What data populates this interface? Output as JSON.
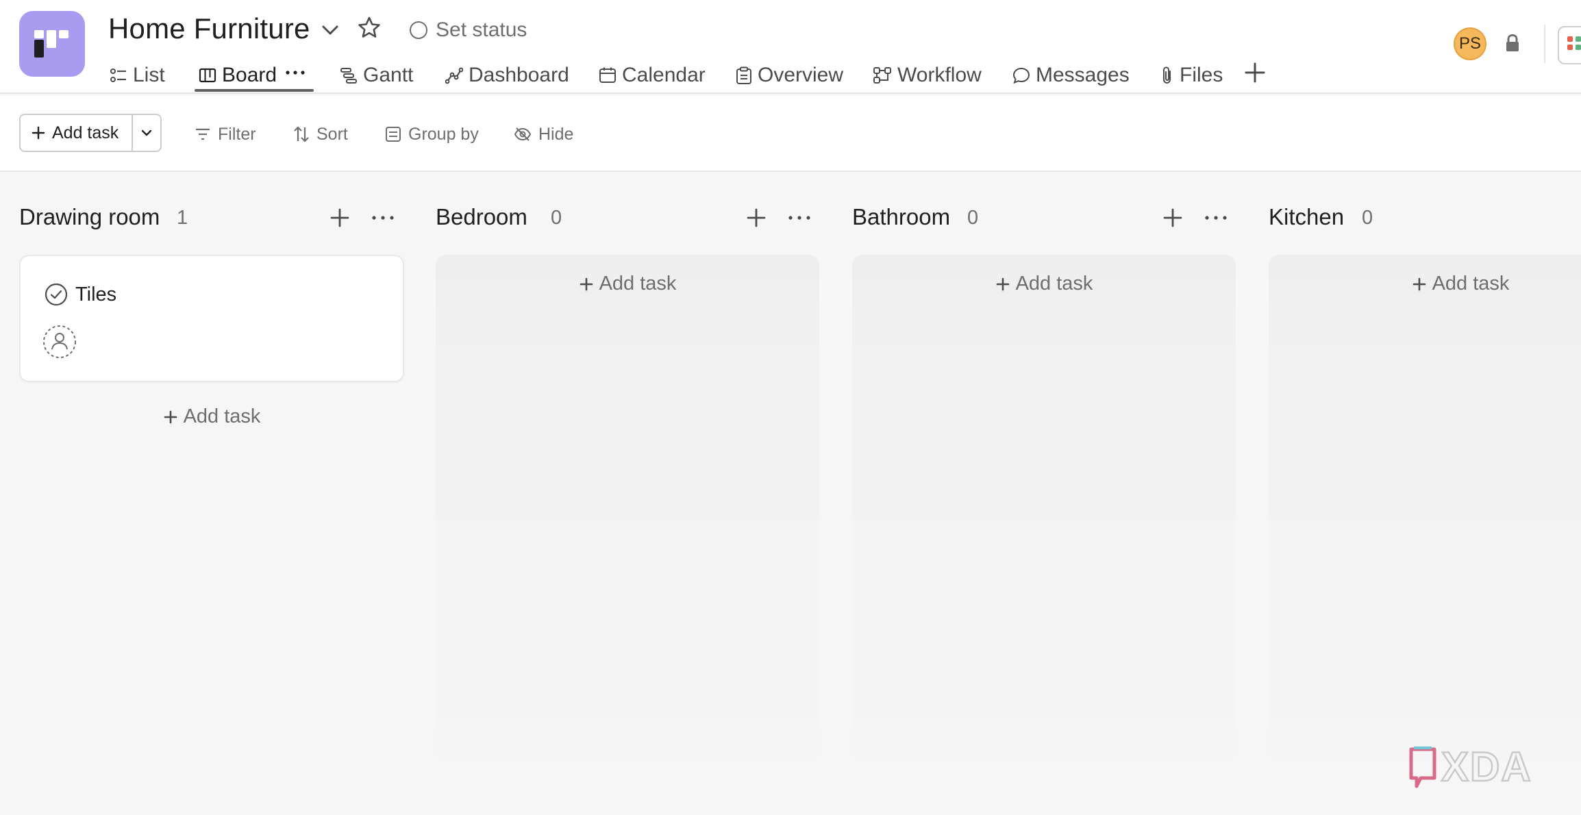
{
  "header": {
    "project_title": "Home Furniture",
    "project_icon": "board-icon",
    "set_status_label": "Set status",
    "avatar_initials": "PS",
    "tabs": [
      {
        "label": "List",
        "icon": "list-icon"
      },
      {
        "label": "Board",
        "icon": "board-icon",
        "active": true
      },
      {
        "label": "Gantt",
        "icon": "gantt-icon"
      },
      {
        "label": "Dashboard",
        "icon": "dashboard-icon"
      },
      {
        "label": "Calendar",
        "icon": "calendar-icon"
      },
      {
        "label": "Overview",
        "icon": "clipboard-icon"
      },
      {
        "label": "Workflow",
        "icon": "workflow-icon"
      },
      {
        "label": "Messages",
        "icon": "speech-bubble-icon"
      },
      {
        "label": "Files",
        "icon": "paperclip-icon"
      }
    ]
  },
  "toolbar": {
    "add_task_label": "Add task",
    "filter_label": "Filter",
    "sort_label": "Sort",
    "group_by_label": "Group by",
    "hide_label": "Hide"
  },
  "board": {
    "columns": [
      {
        "title": "Drawing room",
        "count": "1",
        "add_task_label": "Add task",
        "tasks": [
          {
            "name": "Tiles"
          }
        ]
      },
      {
        "title": "Bedroom",
        "count": "0",
        "add_task_label": "Add task",
        "tasks": []
      },
      {
        "title": "Bathroom",
        "count": "0",
        "add_task_label": "Add task",
        "tasks": []
      },
      {
        "title": "Kitchen",
        "count": "0",
        "add_task_label": "Add task",
        "tasks": []
      }
    ]
  },
  "colors": {
    "project_icon_bg": "#a99bf0",
    "avatar_bg": "#f5b85a",
    "board_bg": "#f6f6f6"
  },
  "watermark": "XDA"
}
